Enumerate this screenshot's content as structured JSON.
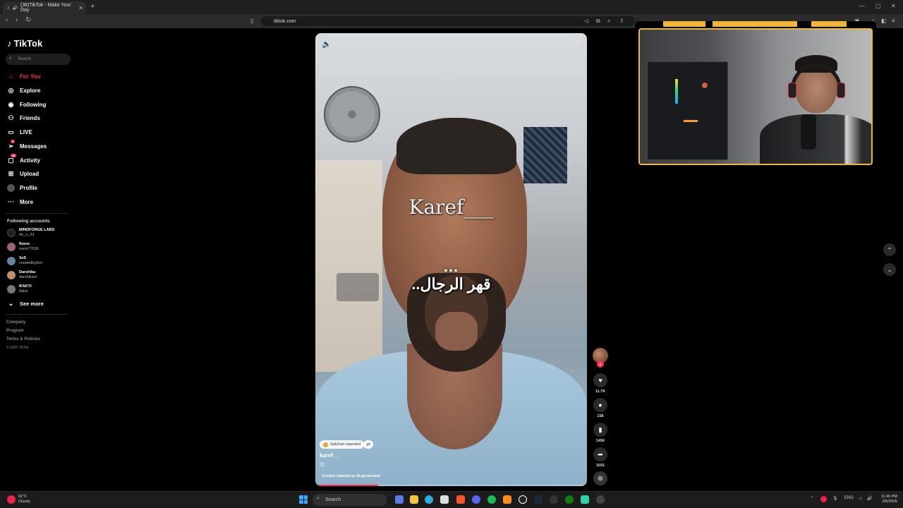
{
  "browser": {
    "tab_title": "(36)TikTok - Make Your Day",
    "new_tab": "+",
    "url": "tiktok.com"
  },
  "tiktok": {
    "logo": "TikTok",
    "search_placeholder": "Search",
    "menu": [
      {
        "label": "For You",
        "icon": "home-icon",
        "active": true
      },
      {
        "label": "Explore",
        "icon": "compass-icon"
      },
      {
        "label": "Following",
        "icon": "following-icon"
      },
      {
        "label": "Friends",
        "icon": "friends-icon"
      },
      {
        "label": "LIVE",
        "icon": "live-icon"
      },
      {
        "label": "Messages",
        "icon": "messages-icon",
        "badge": "3"
      },
      {
        "label": "Activity",
        "icon": "activity-icon",
        "badge": "36"
      },
      {
        "label": "Upload",
        "icon": "upload-icon"
      },
      {
        "label": "Profile",
        "icon": "profile-icon"
      },
      {
        "label": "More",
        "icon": "more-icon"
      }
    ],
    "following_title": "Following accounts",
    "accounts": [
      {
        "name": "MINDFORGE LABS",
        "handle": "do_u_33"
      },
      {
        "name": "Reem",
        "handle": "reem77636"
      },
      {
        "name": "3oS",
        "handle": "createdby3os"
      },
      {
        "name": "Darshika",
        "handle": "darshikanl"
      },
      {
        "name": "IFAKYI",
        "handle": "ifakyi"
      }
    ],
    "see_more": "See more",
    "footer": [
      "Company",
      "Program",
      "Terms & Policies",
      "© 2026 TikTok"
    ]
  },
  "video": {
    "overlay_name": "Karef___",
    "overlay_dots": "...",
    "overlay_arabic": "قهر الرجال..",
    "repost_text": "SabZain reposted",
    "author": "karef__",
    "ai_label": "Creator labeled as AI-generated",
    "progress": 0.23
  },
  "actions": {
    "likes": "11.7K",
    "comments": "158",
    "saves": "1456",
    "shares": "1691"
  },
  "taskbar": {
    "weather_temp": "61°F",
    "weather_desc": "Cloudy",
    "search_label": "Search",
    "lang": "ENG",
    "time": "11:40 PM",
    "date": "2/6/2026"
  },
  "colors": {
    "accent": "#fe2c55",
    "frame": "#f0b43a"
  }
}
